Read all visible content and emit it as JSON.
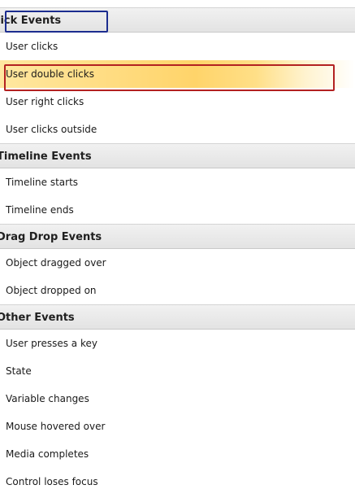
{
  "groups": [
    {
      "header": "lick Events",
      "items": [
        {
          "label": "User clicks",
          "selected": false
        },
        {
          "label": "User double clicks",
          "selected": true
        },
        {
          "label": "User right clicks",
          "selected": false
        },
        {
          "label": "User clicks outside",
          "selected": false
        }
      ]
    },
    {
      "header": "Timeline Events",
      "items": [
        {
          "label": "Timeline starts",
          "selected": false
        },
        {
          "label": "Timeline ends",
          "selected": false
        }
      ]
    },
    {
      "header": "Drag Drop Events",
      "items": [
        {
          "label": "Object dragged over",
          "selected": false
        },
        {
          "label": "Object dropped on",
          "selected": false
        }
      ]
    },
    {
      "header": "Other Events",
      "items": [
        {
          "label": "User presses a key",
          "selected": false
        },
        {
          "label": "State",
          "selected": false
        },
        {
          "label": "Variable changes",
          "selected": false
        },
        {
          "label": "Mouse hovered over",
          "selected": false
        },
        {
          "label": "Media completes",
          "selected": false
        },
        {
          "label": "Control loses focus",
          "selected": false
        }
      ]
    }
  ],
  "colors": {
    "selection": "#ffd46a",
    "focus_box": "#1c2d8f",
    "highlight_box": "#b32121",
    "header_bg": "#e8e8e8"
  }
}
